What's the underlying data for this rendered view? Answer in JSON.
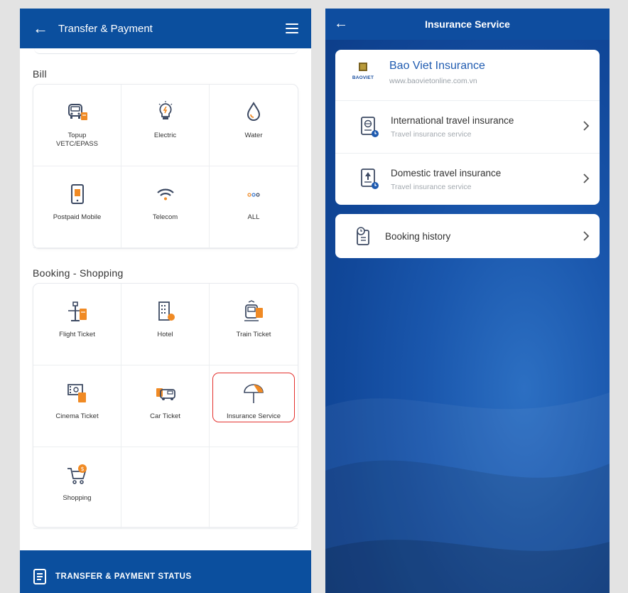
{
  "left": {
    "header": {
      "title": "Transfer & Payment"
    },
    "bill": {
      "title": "Bill",
      "items": [
        {
          "label": "Topup\nVETC/EPASS",
          "icon": "toll-car-icon"
        },
        {
          "label": "Electric",
          "icon": "light-bulb-icon"
        },
        {
          "label": "Water",
          "icon": "water-drop-icon"
        },
        {
          "label": "Postpaid Mobile",
          "icon": "mobile-bill-icon"
        },
        {
          "label": "Telecom",
          "icon": "wifi-icon"
        },
        {
          "label": "ALL",
          "icon": "more-dots-icon"
        }
      ]
    },
    "booking": {
      "title": "Booking - Shopping",
      "items": [
        {
          "label": "Flight Ticket",
          "icon": "airport-tower-icon"
        },
        {
          "label": "Hotel",
          "icon": "hotel-icon"
        },
        {
          "label": "Train Ticket",
          "icon": "train-icon"
        },
        {
          "label": "Cinema Ticket",
          "icon": "film-icon"
        },
        {
          "label": "Car Ticket",
          "icon": "bus-icon"
        },
        {
          "label": "Insurance Service",
          "icon": "umbrella-icon"
        },
        {
          "label": "Shopping",
          "icon": "shopping-cart-icon"
        }
      ]
    },
    "footer": {
      "label": "TRANSFER & PAYMENT STATUS"
    }
  },
  "right": {
    "header": {
      "title": "Insurance Service"
    },
    "provider": {
      "name": "Bao Viet Insurance",
      "url": "www.baovietonline.com.vn",
      "logo_text": "BAOVIET"
    },
    "services": [
      {
        "title": "International travel insurance",
        "subtitle": "Travel insurance service"
      },
      {
        "title": "Domestic travel insurance",
        "subtitle": "Travel insurance service"
      }
    ],
    "history": {
      "label": "Booking history"
    }
  },
  "colors": {
    "primary_blue": "#0b4f9e",
    "accent_orange": "#f08a24",
    "highlight_red": "#e4312d"
  }
}
